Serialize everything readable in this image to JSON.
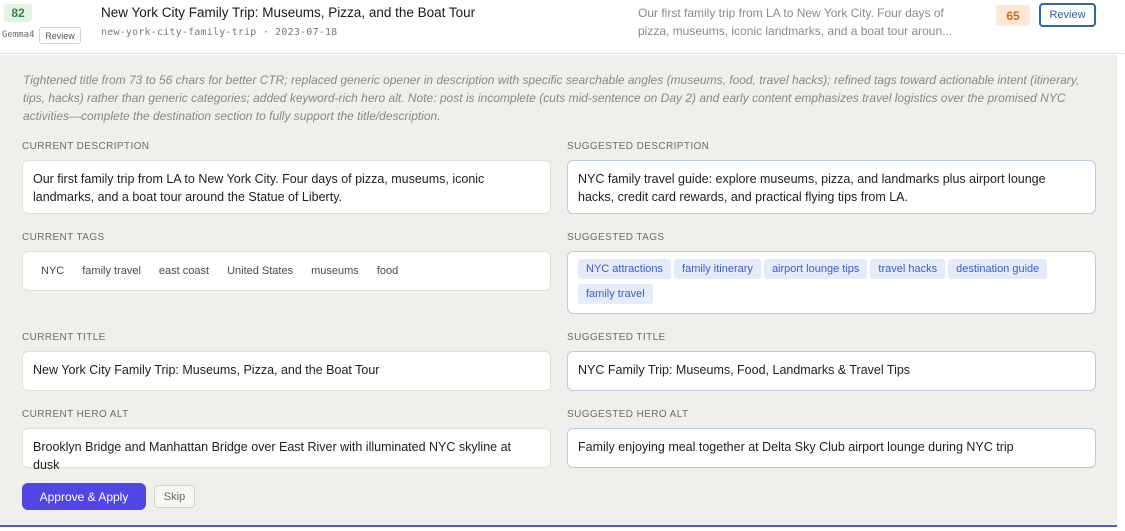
{
  "header": {
    "score_left": "82",
    "model": "Gemma4",
    "review_small": "Review",
    "title": "New York City Family Trip: Museums, Pizza, and the Boat Tour",
    "meta": "new-york-city-family-trip · 2023-07-18",
    "description": "Our first family trip from LA to New York City. Four days of pizza, museums, iconic landmarks, and a boat tour aroun...",
    "score_right": "65",
    "review_label": "Review"
  },
  "panel": {
    "note": "Tightened title from 73 to 56 chars for better CTR; replaced generic opener in description with specific searchable angles (museums, food, travel hacks); refined tags toward actionable intent (itinerary, tips, hacks) rather than generic categories; added keyword-rich hero alt. Note: post is incomplete (cuts mid-sentence on Day 2) and early content emphasizes travel logistics over the promised NYC activities—complete the destination section to fully support the title/description.",
    "current_description_label": "Current Description",
    "current_description": "Our first family trip from LA to New York City. Four days of pizza, museums, iconic landmarks, and a boat tour around the Statue of Liberty.",
    "suggested_description_label": "Suggested Description",
    "suggested_description": "NYC family travel guide: explore museums, pizza, and landmarks plus airport lounge hacks, credit card rewards, and practical flying tips from LA.",
    "current_tags_label": "Current Tags",
    "current_tags": [
      "NYC",
      "family travel",
      "east coast",
      "United States",
      "museums",
      "food"
    ],
    "suggested_tags_label": "Suggested Tags",
    "suggested_tags": [
      "NYC attractions",
      "family itinerary",
      "airport lounge tips",
      "travel hacks",
      "destination guide",
      "family travel"
    ],
    "current_title_label": "Current Title",
    "current_title": "New York City Family Trip: Museums, Pizza, and the Boat Tour",
    "suggested_title_label": "Suggested Title",
    "suggested_title": "NYC Family Trip: Museums, Food, Landmarks & Travel Tips",
    "current_hero_alt_label": "Current Hero Alt",
    "current_hero_alt": "Brooklyn Bridge and Manhattan Bridge over East River with illuminated NYC skyline at dusk",
    "suggested_hero_alt_label": "Suggested Hero Alt",
    "suggested_hero_alt": "Family enjoying meal together at Delta Sky Club airport lounge during NYC trip",
    "approve_label": "Approve & Apply",
    "skip_label": "Skip"
  }
}
